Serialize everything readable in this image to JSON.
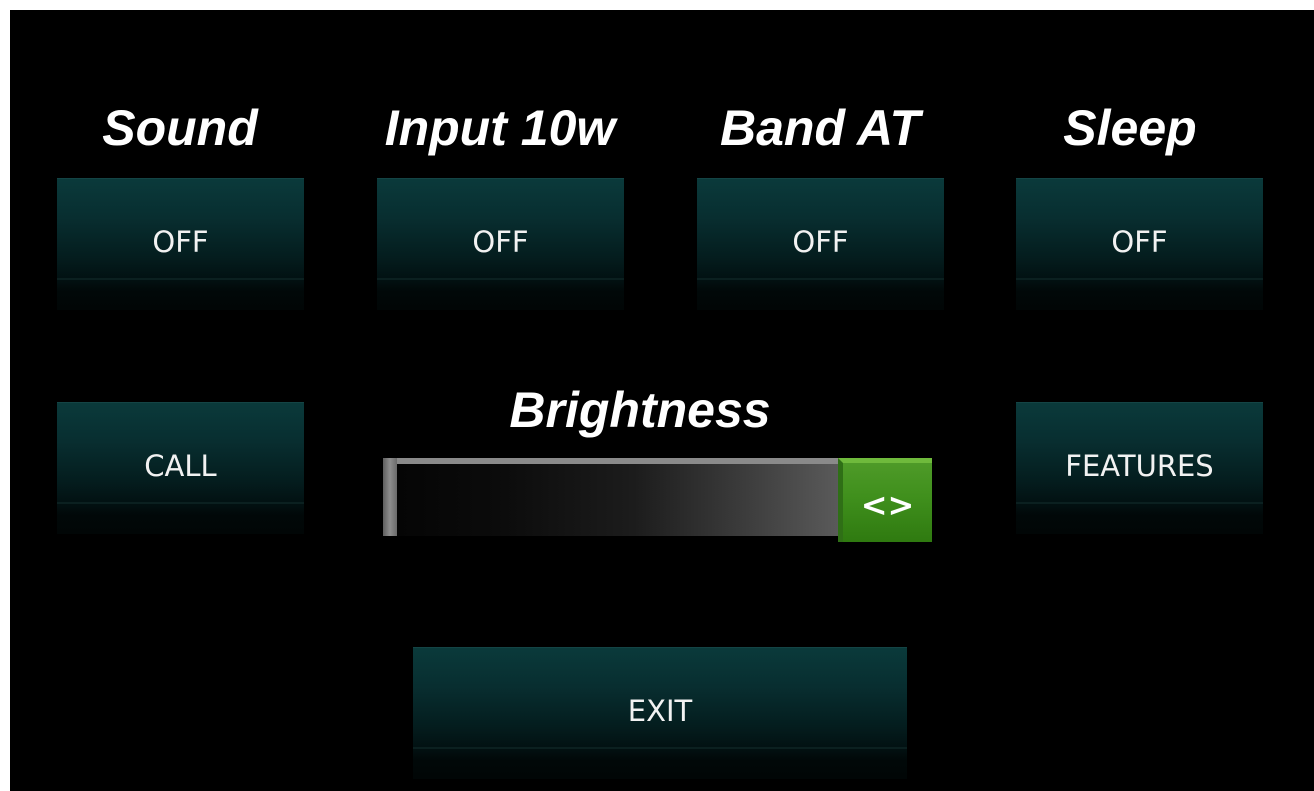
{
  "headings": {
    "sound": "Sound",
    "input": "Input 10w",
    "band": "Band AT",
    "sleep": "Sleep",
    "brightness": "Brightness"
  },
  "buttons": {
    "sound": "OFF",
    "input": "OFF",
    "band": "OFF",
    "sleep": "OFF",
    "call": "CALL",
    "features": "FEATURES",
    "exit": "EXIT"
  },
  "brightness": {
    "handle_label": "<>",
    "level": 1.0
  },
  "colors": {
    "background": "#000000",
    "button": "#0a3a3b",
    "slider_handle": "#3f8f1c",
    "text": "#ffffff"
  }
}
